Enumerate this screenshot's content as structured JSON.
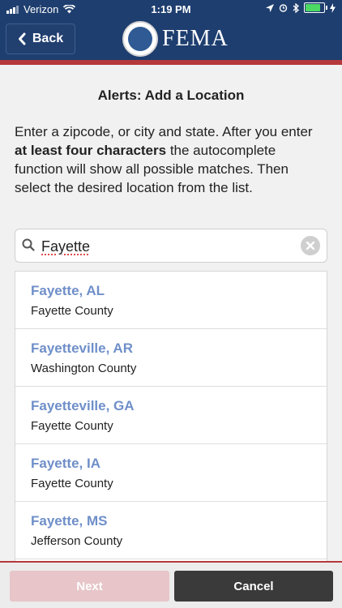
{
  "status_bar": {
    "carrier": "Verizon",
    "time": "1:19 PM",
    "battery_percent": 0.9
  },
  "header": {
    "back_label": "Back",
    "brand": "FEMA"
  },
  "page": {
    "title": "Alerts: Add a Location",
    "instructions_pre": "Enter a zipcode, or city and state. After you enter ",
    "instructions_bold": "at least four characters",
    "instructions_post": " the autocomplete function will show all possible matches. Then select the desired location from the list."
  },
  "search": {
    "value": "Fayette"
  },
  "results": [
    {
      "name": "Fayette, AL",
      "county": "Fayette County"
    },
    {
      "name": "Fayetteville, AR",
      "county": "Washington County"
    },
    {
      "name": "Fayetteville, GA",
      "county": "Fayette County"
    },
    {
      "name": "Fayette, IA",
      "county": "Fayette County"
    },
    {
      "name": "Fayette, MS",
      "county": "Jefferson County"
    }
  ],
  "footer": {
    "next_label": "Next",
    "cancel_label": "Cancel"
  },
  "colors": {
    "header_bg": "#1e3e6f",
    "accent_red": "#b5383a",
    "link_blue": "#6f8fc9",
    "next_disabled": "#e7c5c8",
    "cancel_bg": "#3a3a3a"
  }
}
